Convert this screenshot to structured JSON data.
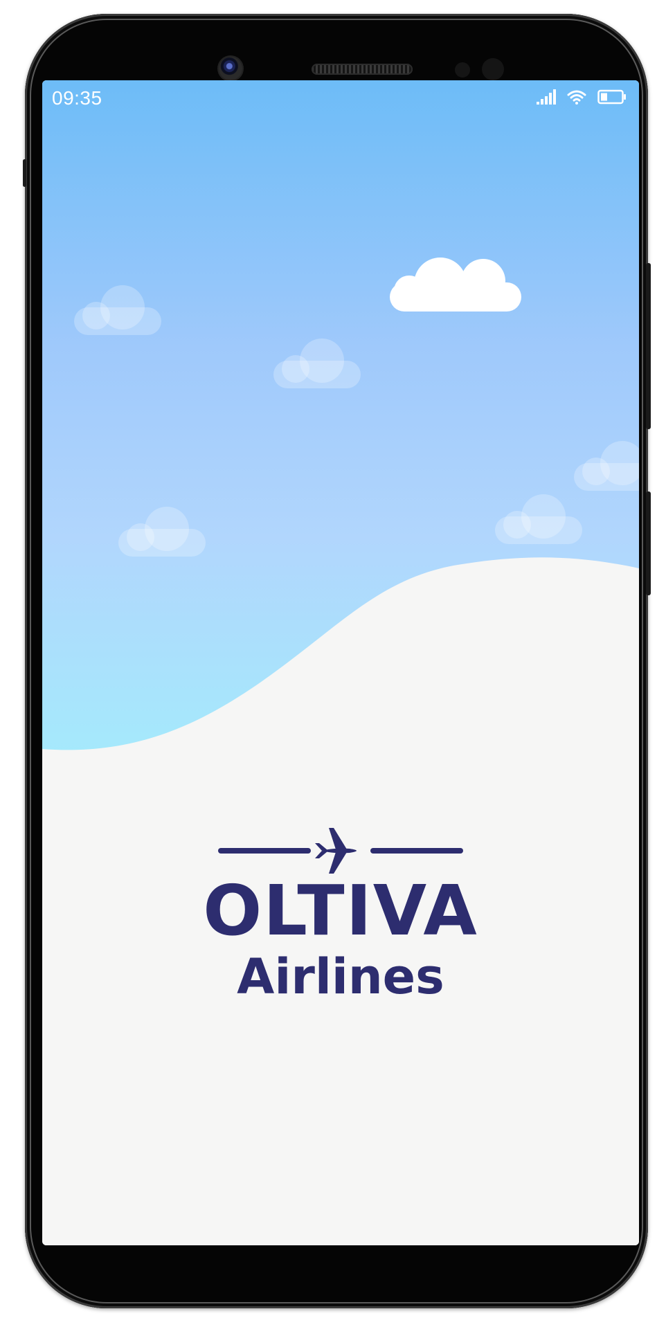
{
  "status_bar": {
    "time": "09:35",
    "icons": [
      "signal-icon",
      "wifi-icon",
      "battery-icon"
    ]
  },
  "splash": {
    "brand_name": "OLTIVA",
    "brand_subtitle": "Airlines",
    "logo_icon": "airplane-icon"
  },
  "colors": {
    "sky_top": "#6dbcf7",
    "sky_bottom": "#a0f1fb",
    "ground": "#f6f6f5",
    "brand": "#2d2d6f",
    "cloud": "#ffffff"
  }
}
